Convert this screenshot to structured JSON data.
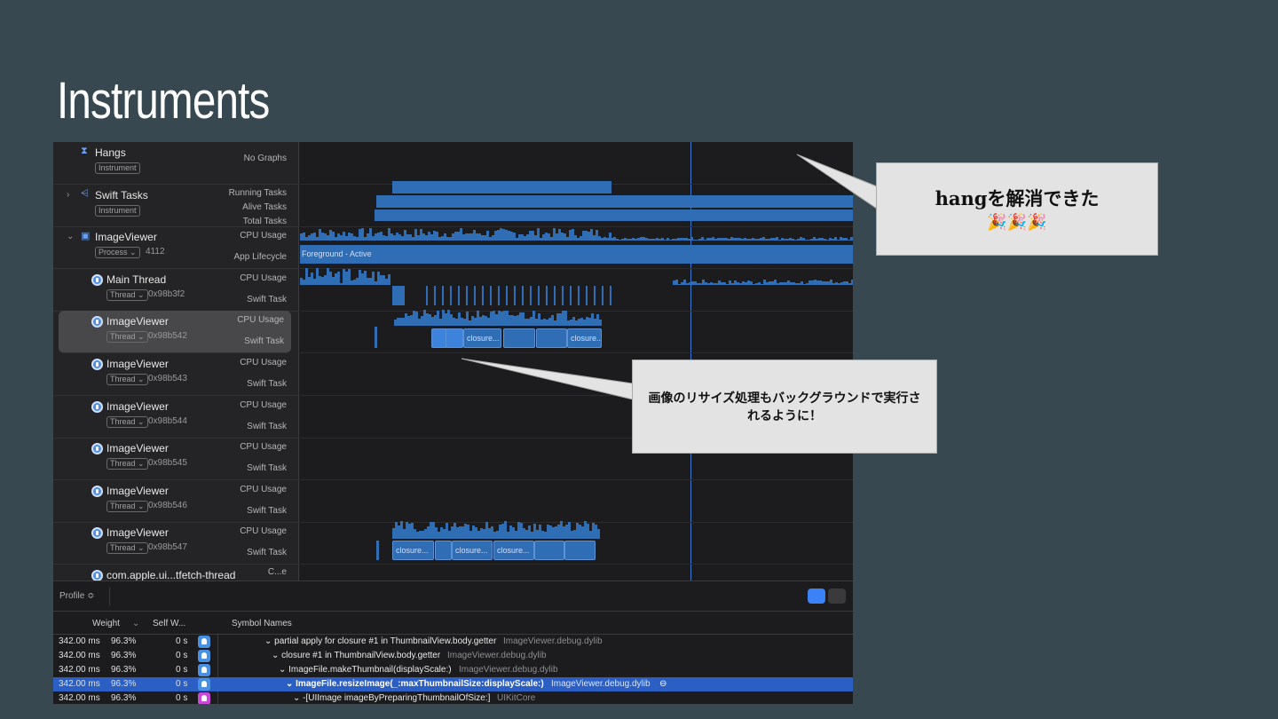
{
  "slide": {
    "title": "Instruments"
  },
  "tracks": [
    {
      "name": "Hangs",
      "tag": "Instrument",
      "labels": [
        "No Graphs"
      ],
      "icon": "hourglass-icon"
    },
    {
      "name": "Swift Tasks",
      "tag": "Instrument",
      "labels": [
        "Running Tasks",
        "Alive Tasks",
        "Total Tasks"
      ],
      "icon": "swift-tasks-icon"
    },
    {
      "name": "ImageViewer",
      "tag": "Process ⌄",
      "id": "4112",
      "labels": [
        "CPU Usage",
        "App Lifecycle"
      ],
      "icon": "app-icon",
      "lifecycle": "Foreground - Active"
    },
    {
      "name": "Main Thread",
      "tag": "Thread ⌄",
      "id": "0x98b3f2",
      "labels": [
        "CPU Usage",
        "Swift Task"
      ]
    },
    {
      "name": "ImageViewer",
      "tag": "Thread ⌄",
      "id": "0x98b542",
      "labels": [
        "CPU Usage",
        "Swift Task"
      ],
      "selected": true
    },
    {
      "name": "ImageViewer",
      "tag": "Thread ⌄",
      "id": "0x98b543",
      "labels": [
        "CPU Usage",
        "Swift Task"
      ]
    },
    {
      "name": "ImageViewer",
      "tag": "Thread ⌄",
      "id": "0x98b544",
      "labels": [
        "CPU Usage",
        "Swift Task"
      ]
    },
    {
      "name": "ImageViewer",
      "tag": "Thread ⌄",
      "id": "0x98b545",
      "labels": [
        "CPU Usage",
        "Swift Task"
      ]
    },
    {
      "name": "ImageViewer",
      "tag": "Thread ⌄",
      "id": "0x98b546",
      "labels": [
        "CPU Usage",
        "Swift Task"
      ]
    },
    {
      "name": "ImageViewer",
      "tag": "Thread ⌄",
      "id": "0x98b547",
      "labels": [
        "CPU Usage",
        "Swift Task"
      ]
    },
    {
      "name": "com.apple.ui...tfetch-thread",
      "labels": [
        "C...e"
      ]
    }
  ],
  "closures": {
    "thread542": [
      "",
      "",
      "closure...",
      "",
      "",
      "closure..."
    ],
    "thread547": [
      "closure...",
      "",
      "closure...",
      "closure...",
      "",
      ""
    ]
  },
  "bottom": {
    "profile": "Profile ≎",
    "columns": {
      "weight": "Weight",
      "self": "Self W...",
      "symbol": "Symbol Names"
    },
    "rows": [
      {
        "weight": "342.00 ms",
        "pct": "96.3%",
        "self": "0 s",
        "symbol": "⌄ partial apply for closure #1 in ThumbnailView.body.getter",
        "lib": "ImageViewer.debug.dylib",
        "indent": 52,
        "icon": "user"
      },
      {
        "weight": "342.00 ms",
        "pct": "96.3%",
        "self": "0 s",
        "symbol": "⌄ closure #1 in ThumbnailView.body.getter",
        "lib": "ImageViewer.debug.dylib",
        "indent": 60,
        "icon": "user"
      },
      {
        "weight": "342.00 ms",
        "pct": "96.3%",
        "self": "0 s",
        "symbol": "⌄ ImageFile.makeThumbnail(displayScale:)",
        "lib": "ImageViewer.debug.dylib",
        "indent": 68,
        "icon": "user"
      },
      {
        "weight": "342.00 ms",
        "pct": "96.3%",
        "self": "0 s",
        "symbol": "⌄ ImageFile.resizeImage(_:maxThumbnailSize:displayScale:)",
        "lib": "ImageViewer.debug.dylib",
        "indent": 76,
        "icon": "user",
        "highlight": true
      },
      {
        "weight": "342.00 ms",
        "pct": "96.3%",
        "self": "0 s",
        "symbol": "⌄ -[UIImage imageByPreparingThumbnailOfSize:]",
        "lib": "UIKitCore",
        "indent": 84,
        "icon": "framework"
      }
    ]
  },
  "callouts": {
    "hang": {
      "text": "hangを解消できた",
      "emoji": "🎉🎉🎉"
    },
    "background": {
      "text": "画像のリサイズ処理もバックグラウンドで実行されるように！"
    }
  },
  "colors": {
    "accent": "#2f6db5",
    "slide_bg": "#374851",
    "highlight": "#2c5fc4"
  }
}
